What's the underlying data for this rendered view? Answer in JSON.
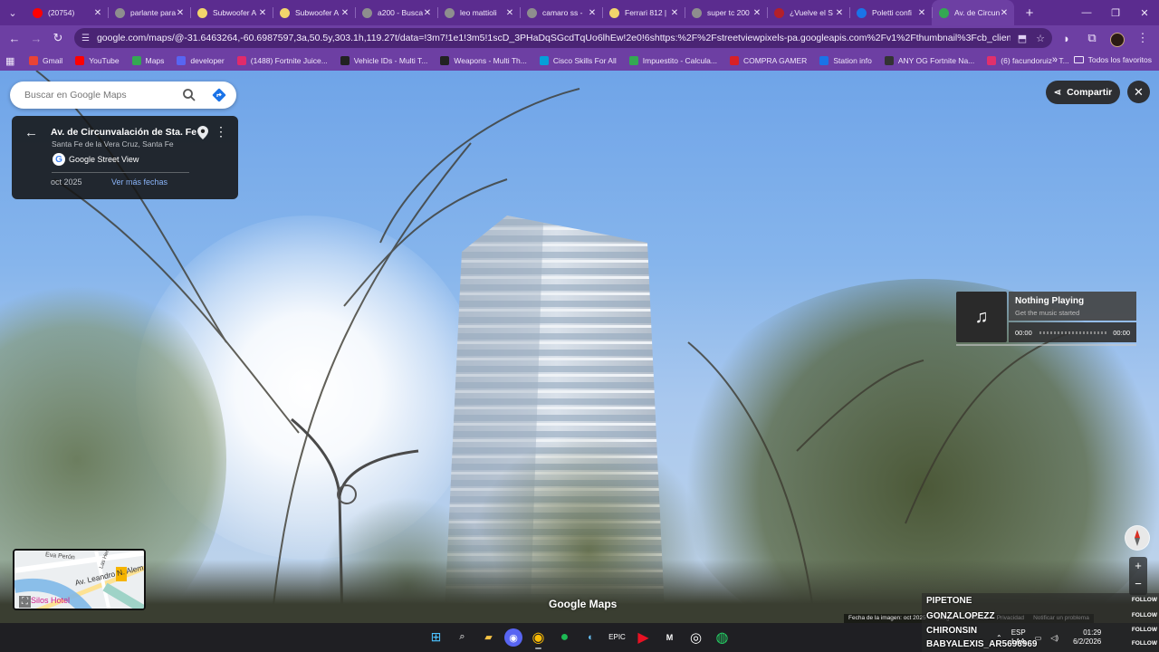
{
  "browser": {
    "tabs": [
      {
        "title": "(20754)",
        "color": "#ff0000"
      },
      {
        "title": "parlante para",
        "color": "#8e8e8e"
      },
      {
        "title": "Subwoofer A",
        "color": "#f2d56b"
      },
      {
        "title": "Subwoofer A",
        "color": "#f2d56b"
      },
      {
        "title": "a200 - Buscar",
        "color": "#8e8e8e"
      },
      {
        "title": "leo mattioli",
        "color": "#8e8e8e"
      },
      {
        "title": "camaro ss -",
        "color": "#8e8e8e"
      },
      {
        "title": "Ferrari 812 |",
        "color": "#f2d56b"
      },
      {
        "title": "super tc 200",
        "color": "#8e8e8e"
      },
      {
        "title": "¿Vuelve el S",
        "color": "#b3202a"
      },
      {
        "title": "Poletti confi",
        "color": "#1a73e8"
      },
      {
        "title": "Av. de Circun",
        "color": "#34a853",
        "active": true
      }
    ],
    "address": "google.com/maps/@-31.6463264,-60.6987597,3a,50.5y,303.1h,119.27t/data=!3m7!1e1!3m5!1scD_3PHaDqSGcdTqUo6lhEw!2e0!6shttps:%2F%2Fstreetviewpixels-pa.googleapis.com%2Fv1%2Fthumbnail%3Fcb_client%3Dmaps_sv.tactile%26w%3D...",
    "bookmarks": [
      {
        "label": "Gmail",
        "color": "#ea4335"
      },
      {
        "label": "YouTube",
        "color": "#ff0000"
      },
      {
        "label": "Maps",
        "color": "#34a853"
      },
      {
        "label": "developer",
        "color": "#5865f2"
      },
      {
        "label": "(1488) Fortnite Juice...",
        "color": "#e02b6b"
      },
      {
        "label": "Vehicle IDs - Multi T...",
        "color": "#222222"
      },
      {
        "label": "Weapons - Multi Th...",
        "color": "#222222"
      },
      {
        "label": "Cisco Skills For All",
        "color": "#049fd9"
      },
      {
        "label": "Impuestito - Calcula...",
        "color": "#34a853"
      },
      {
        "label": "COMPRA GAMER",
        "color": "#d92027"
      },
      {
        "label": "Station info",
        "color": "#1a73e8"
      },
      {
        "label": "ANY OG Fortnite Na...",
        "color": "#333333"
      },
      {
        "label": "(6) facundoruiz - T...",
        "color": "#e1306c"
      }
    ],
    "all_bookmarks": "Todos los favoritos"
  },
  "maps": {
    "search_placeholder": "Buscar en Google Maps",
    "place_title": "Av. de Circunvalación de Sta. Fe",
    "place_subtitle": "Santa Fe de la Vera Cruz, Santa Fe",
    "source": "Google Street View",
    "google_letter": "G",
    "date": "oct 2025",
    "more_dates": "Ver más fechas",
    "share": "Compartir",
    "logo": "Google Maps",
    "footer": [
      "Fecha de la imagen: oct 2025",
      "Google",
      "Términos",
      "Privacidad",
      "Notificar un problema"
    ],
    "minimap": {
      "street1": "Eva Perón",
      "street2": "Av. Leandro N. Alem",
      "street3": "Las Heras",
      "hotel": "Silos Hotel"
    }
  },
  "player": {
    "status": "Nothing Playing",
    "subtitle": "Get the music started",
    "time_current": "00:00",
    "time_total": "00:00"
  },
  "chat": {
    "names": [
      "PIPETONE",
      "GONZALOPEZZ",
      "CHIRONSIN",
      "BABYALEXIS_AR5696969"
    ],
    "action": "FOLLOW"
  },
  "taskbar": {
    "lang_top": "ESP",
    "lang_bottom": "LAA",
    "time": "01:29",
    "date": "6/2/2026"
  }
}
